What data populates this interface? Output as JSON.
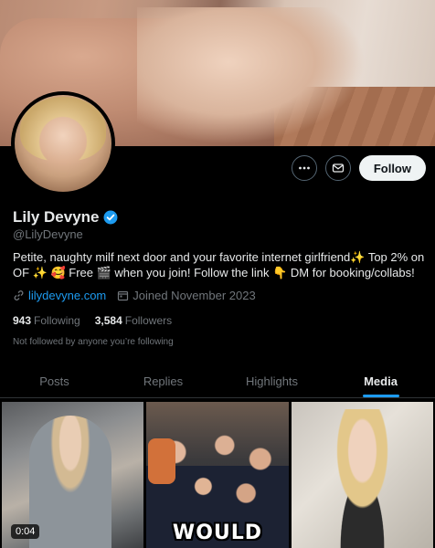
{
  "profile": {
    "name": "Lily Devyne",
    "handle": "@LilyDevyne",
    "bio": "Petite, naughty milf next door and your favorite internet girlfriend✨ Top 2% on OF ✨ 🥰 Free 🎬 when you join! Follow the link 👇 DM for booking/collabs!",
    "website": "lilydevyne.com",
    "joined": "Joined November 2023",
    "following_count": "943",
    "following_label": "Following",
    "followers_count": "3,584",
    "followers_label": "Followers",
    "not_followed": "Not followed by anyone you’re following",
    "verified_icon": "verified-badge-icon"
  },
  "actions": {
    "more_icon": "more-icon",
    "message_icon": "envelope-icon",
    "follow_label": "Follow"
  },
  "tabs": [
    {
      "label": "Posts"
    },
    {
      "label": "Replies"
    },
    {
      "label": "Highlights"
    },
    {
      "label": "Media",
      "active": true
    }
  ],
  "media": {
    "video_duration": "0:04",
    "caption_text": "WOULD"
  },
  "colors": {
    "accent": "#1d9bf0",
    "background": "#000000",
    "muted": "#71767b"
  }
}
